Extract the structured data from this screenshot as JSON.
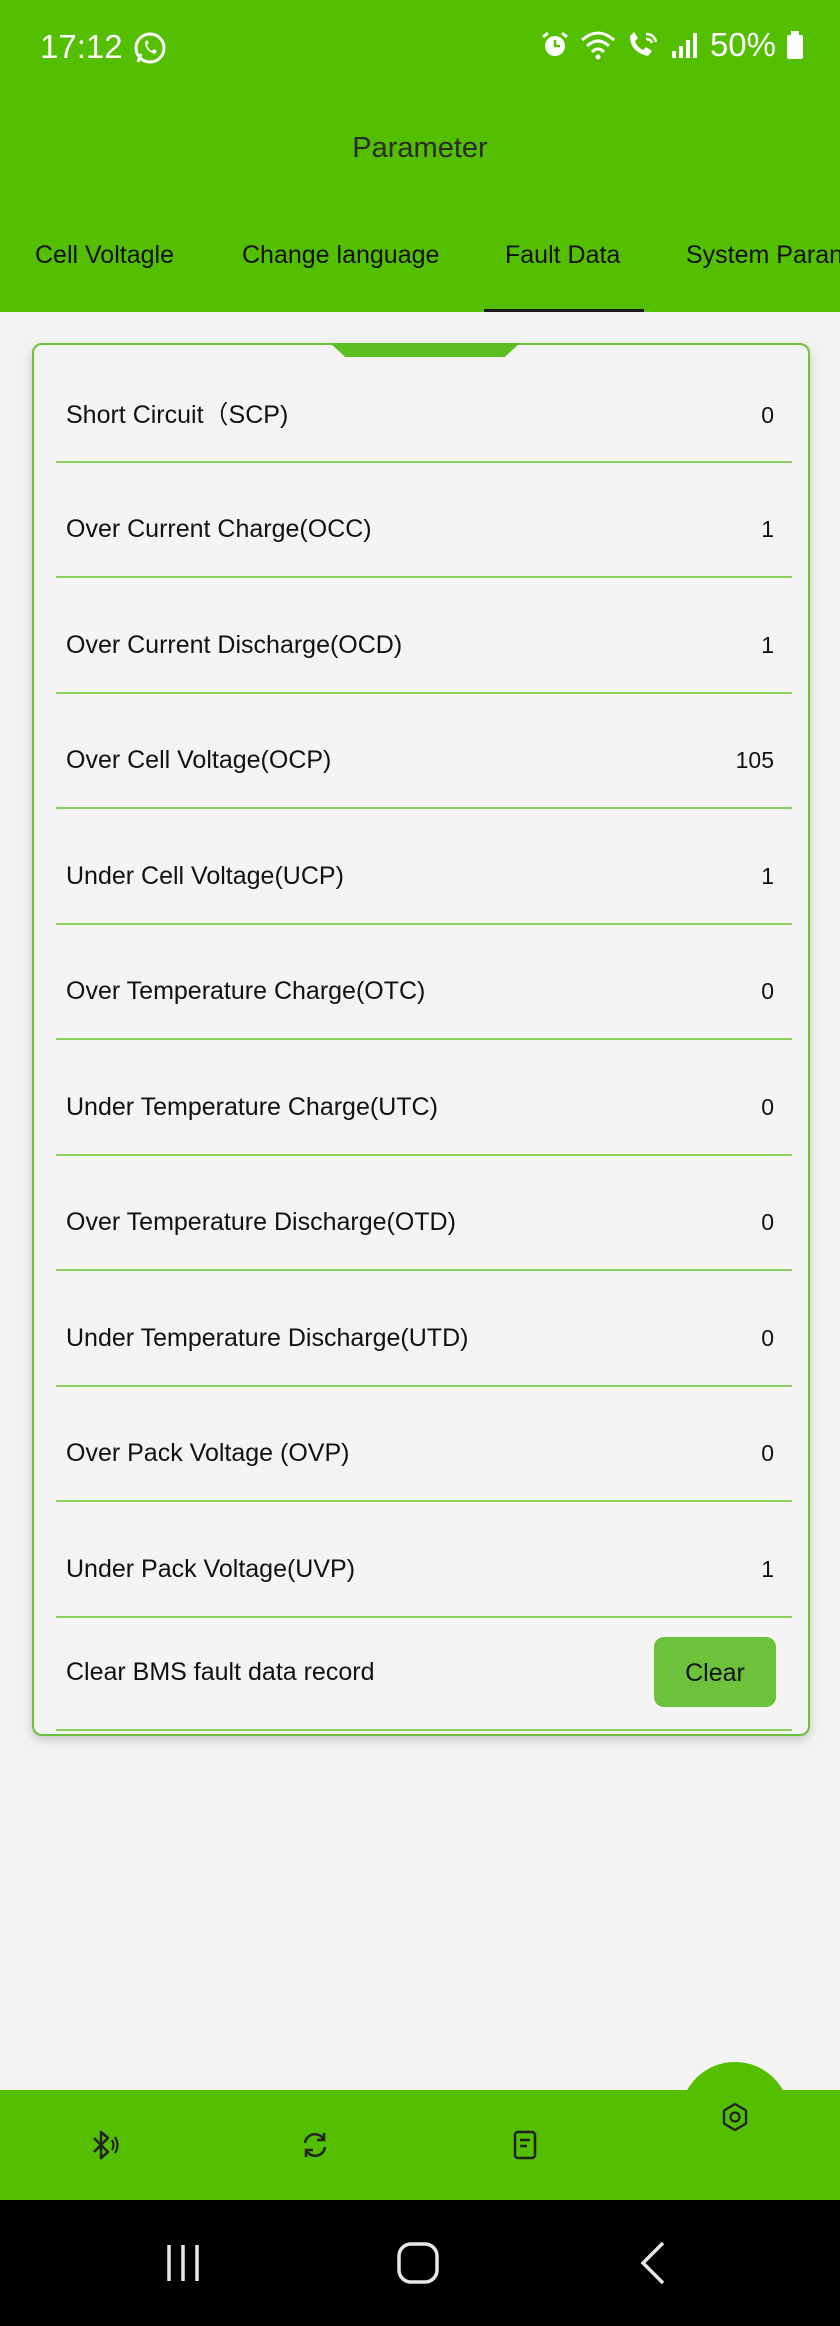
{
  "status_bar": {
    "time": "17:12",
    "battery": "50%"
  },
  "header": {
    "title": "Parameter"
  },
  "tabs": [
    {
      "label": "Cell Voltagle"
    },
    {
      "label": "Change language"
    },
    {
      "label": "Fault Data",
      "active": true
    },
    {
      "label": "System Paran"
    }
  ],
  "fault_data": {
    "rows": [
      {
        "label": "Short Circuit（SCP)",
        "value": "0"
      },
      {
        "label": "Over Current Charge(OCC)",
        "value": "1"
      },
      {
        "label": "Over Current Discharge(OCD)",
        "value": "1"
      },
      {
        "label": "Over Cell Voltage(OCP)",
        "value": "105"
      },
      {
        "label": "Under Cell Voltage(UCP)",
        "value": "1"
      },
      {
        "label": "Over Temperature Charge(OTC)",
        "value": "0"
      },
      {
        "label": "Under Temperature Charge(UTC)",
        "value": "0"
      },
      {
        "label": "Over Temperature Discharge(OTD)",
        "value": "0"
      },
      {
        "label": "Under Temperature Discharge(UTD)",
        "value": "0"
      },
      {
        "label": "Over Pack Voltage (OVP)",
        "value": "0"
      },
      {
        "label": "Under Pack Voltage(UVP)",
        "value": "1"
      }
    ],
    "clear_label": "Clear BMS fault data record",
    "clear_button": "Clear"
  },
  "bottom_nav": {
    "items": [
      {
        "icon": "bluetooth-icon"
      },
      {
        "icon": "refresh-icon"
      },
      {
        "icon": "document-icon"
      },
      {
        "icon": "settings-icon",
        "active": true
      }
    ]
  },
  "colors": {
    "brand": "#54be00",
    "accent": "#6cc23a",
    "divider": "#88d25e",
    "background": "#f3f3f3"
  }
}
